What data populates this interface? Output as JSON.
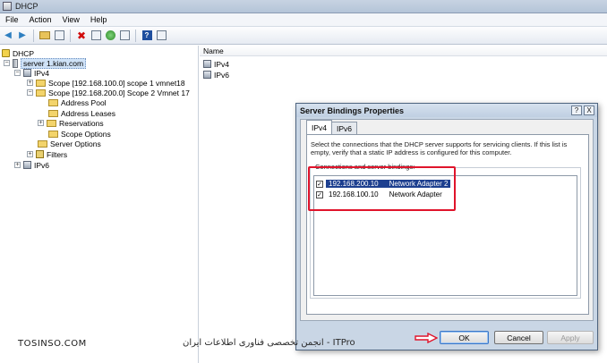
{
  "window": {
    "title": "DHCP"
  },
  "menu": [
    "File",
    "Action",
    "View",
    "Help"
  ],
  "tree": {
    "root": "DHCP",
    "server": "server 1.kian.com",
    "ipv4": "IPv4",
    "scope1": "Scope [192.168.100.0] scope 1 vmnet18",
    "scope2": "Scope [192.168.200.0] Scope 2 Vmnet 17",
    "address_pool": "Address Pool",
    "address_leases": "Address Leases",
    "reservations": "Reservations",
    "scope_options": "Scope Options",
    "server_options": "Server Options",
    "filters": "Filters",
    "ipv6": "IPv6"
  },
  "list": {
    "column_name": "Name",
    "items": [
      "IPv4",
      "IPv6"
    ]
  },
  "dialog": {
    "title": "Server Bindings Properties",
    "help_button": "?",
    "close_button": "X",
    "tabs": [
      "IPv4",
      "IPv6"
    ],
    "description": "Select the connections that the DHCP server supports for servicing clients. If this list is empty, verify that a static IP address is configured for this computer.",
    "group_label": "Connections and server bindings:",
    "bindings": [
      {
        "ip": "192.168.200.10",
        "adapter": "Network Adapter 2",
        "checked": true,
        "selected": true
      },
      {
        "ip": "192.168.100.10",
        "adapter": "Network Adapter",
        "checked": true,
        "selected": false
      }
    ],
    "ok_label": "OK",
    "cancel_label": "Cancel",
    "apply_label": "Apply"
  },
  "watermark": {
    "left": "TOSINSO.COM",
    "right": "ITPro - انجمن تخصصی فناوری اطلاعات ایران"
  },
  "colors": {
    "annotation_red": "#e0142b",
    "selection_blue": "#1d3f8f"
  }
}
